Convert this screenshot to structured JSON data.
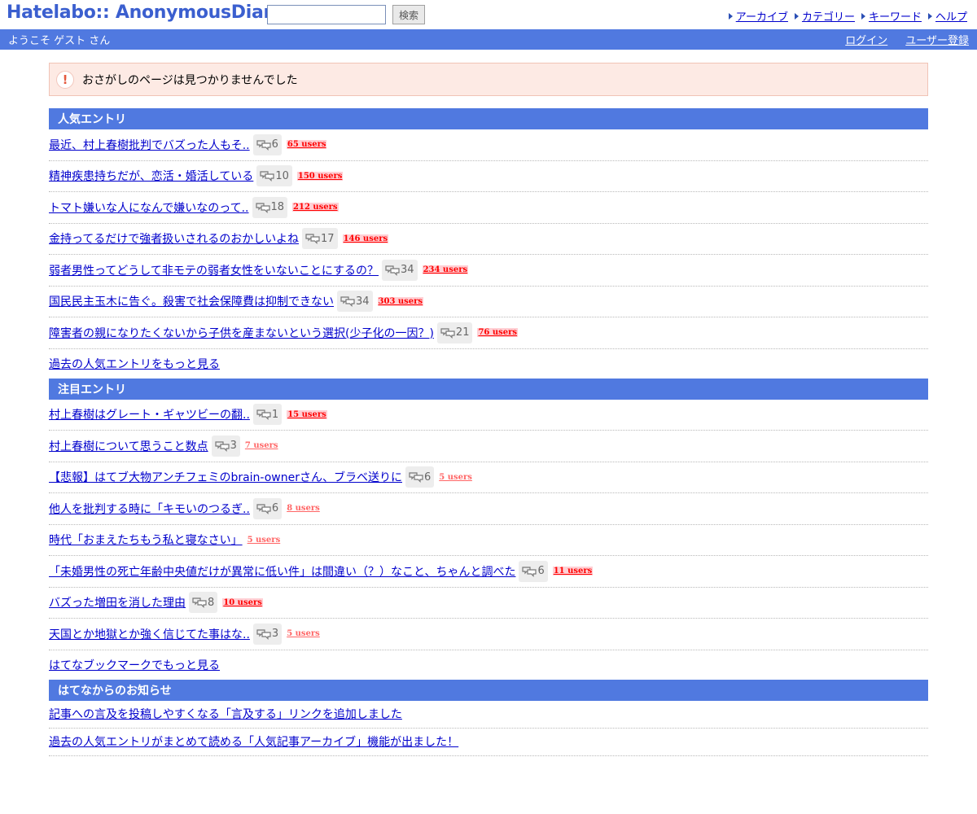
{
  "header": {
    "logo": "Hatelabo:: AnonymousDiary",
    "search_placeholder": "",
    "search_button": "検索",
    "nav": [
      "アーカイブ",
      "カテゴリー",
      "キーワード",
      "ヘルプ"
    ]
  },
  "welcome": {
    "greeting": "ようこそ ゲスト さん",
    "login": "ログイン",
    "register": "ユーザー登録"
  },
  "notice": {
    "icon": "!",
    "text": "おさがしのページは見つかりませんでした"
  },
  "popular": {
    "heading": "人気エントリ",
    "more": "過去の人気エントリをもっと見る",
    "entries": [
      {
        "title": "最近、村上春樹批判でバズった人もそ..",
        "comments": "6",
        "users": "65 users",
        "style": "hot"
      },
      {
        "title": "精神疾患持ちだが、恋活・婚活している",
        "comments": "10",
        "users": "150 users",
        "style": "hot"
      },
      {
        "title": "トマト嫌いな人になんで嫌いなのって..",
        "comments": "18",
        "users": "212 users",
        "style": "hot"
      },
      {
        "title": "金持ってるだけで強者扱いされるのおかしいよね",
        "comments": "17",
        "users": "146 users",
        "style": "hot"
      },
      {
        "title": "弱者男性ってどうして非モテの弱者女性をいないことにするの？",
        "comments": "34",
        "users": "234 users",
        "style": "hot"
      },
      {
        "title": "国民民主玉木に告ぐ。殺害で社会保障費は抑制できない",
        "comments": "34",
        "users": "303 users",
        "style": "hot"
      },
      {
        "title": "障害者の親になりたくないから子供を産まないという選択(少子化の一因？)",
        "comments": "21",
        "users": "76 users",
        "style": "hot"
      }
    ]
  },
  "notable": {
    "heading": "注目エントリ",
    "more": "はてなブックマークでもっと見る",
    "entries": [
      {
        "title": "村上春樹はグレート・ギャツビーの翻..",
        "comments": "1",
        "users": "15 users",
        "style": "hot"
      },
      {
        "title": "村上春樹について思うこと数点",
        "comments": "3",
        "users": "7 users",
        "style": "mild"
      },
      {
        "title": "【悲報】はてブ大物アンチフェミのbrain-ownerさん、ブラベ送りに",
        "comments": "6",
        "users": "5 users",
        "style": "mild"
      },
      {
        "title": "他人を批判する時に「キモいのつるぎ..",
        "comments": "6",
        "users": "8 users",
        "style": "mild"
      },
      {
        "title": "時代「おまえたちもう私と寝なさい」",
        "comments": "",
        "users": "5 users",
        "style": "mild"
      },
      {
        "title": "「未婚男性の死亡年齢中央値だけが異常に低い件」は間違い（？）なこと、ちゃんと調べた",
        "comments": "6",
        "users": "11 users",
        "style": "hot"
      },
      {
        "title": "バズった増田を消した理由",
        "comments": "8",
        "users": "10 users",
        "style": "hot"
      },
      {
        "title": "天国とか地獄とか強く信じてた事はな..",
        "comments": "3",
        "users": "5 users",
        "style": "mild"
      }
    ]
  },
  "news": {
    "heading": "はてなからのお知らせ",
    "items": [
      "記事への言及を投稿しやすくなる「言及する」リンクを追加しました",
      "過去の人気エントリがまとめて読める「人気記事アーカイブ」機能が出ました！"
    ]
  },
  "colors": {
    "accent": "#5079e0",
    "link": "#0000cc",
    "hot_users": "#ff0000",
    "mild_users": "#ff6666",
    "notice_bg": "#fdeae4"
  }
}
